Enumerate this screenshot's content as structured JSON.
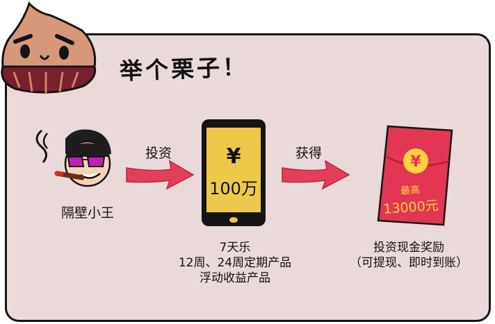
{
  "headline": "举个栗子！",
  "investor": {
    "name": "隔壁小王"
  },
  "step1": {
    "label": "投资"
  },
  "phone": {
    "currency": "¥",
    "amount": "100万"
  },
  "step2": {
    "label": "获得"
  },
  "product": {
    "lines": [
      "7天乐",
      "12周、24周定期产品",
      "浮动收益产品"
    ]
  },
  "envelope": {
    "currency": "¥",
    "label": "最高",
    "amount": "13000元"
  },
  "reward": {
    "lines": [
      "投资现金奖励",
      "（可提现、即时到账）"
    ]
  },
  "colors": {
    "card_bg": "#ead9d9",
    "arrow": "#e43f5a",
    "phone_screen": "#eec84a",
    "envelope": "#e23654",
    "gold": "#ffd23f"
  }
}
